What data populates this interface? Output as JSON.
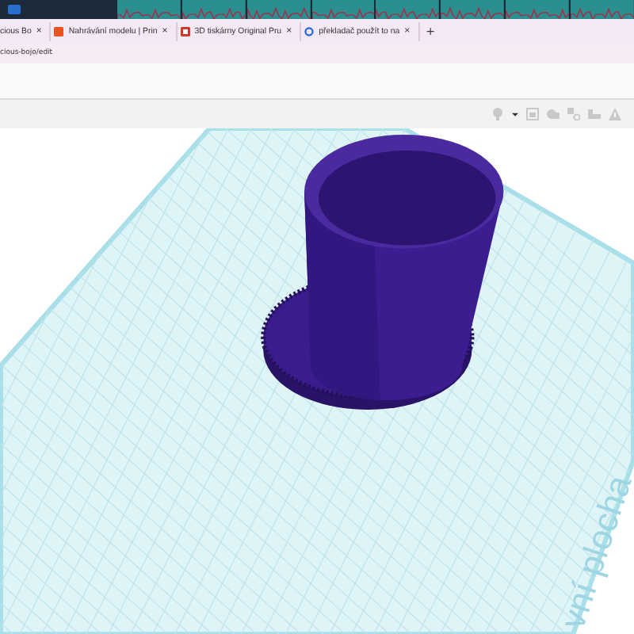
{
  "tabs": [
    {
      "title": "cious Bo",
      "close": "×"
    },
    {
      "title": "Nahrávání modelu | Prin",
      "close": "×"
    },
    {
      "title": "3D tiskárny Original Pru",
      "close": "×"
    },
    {
      "title": "překladač použít to na",
      "close": "×"
    }
  ],
  "new_tab": "+",
  "address": "cious-bojo/edit",
  "viewport": {
    "workplane_label": "vní plocha"
  }
}
